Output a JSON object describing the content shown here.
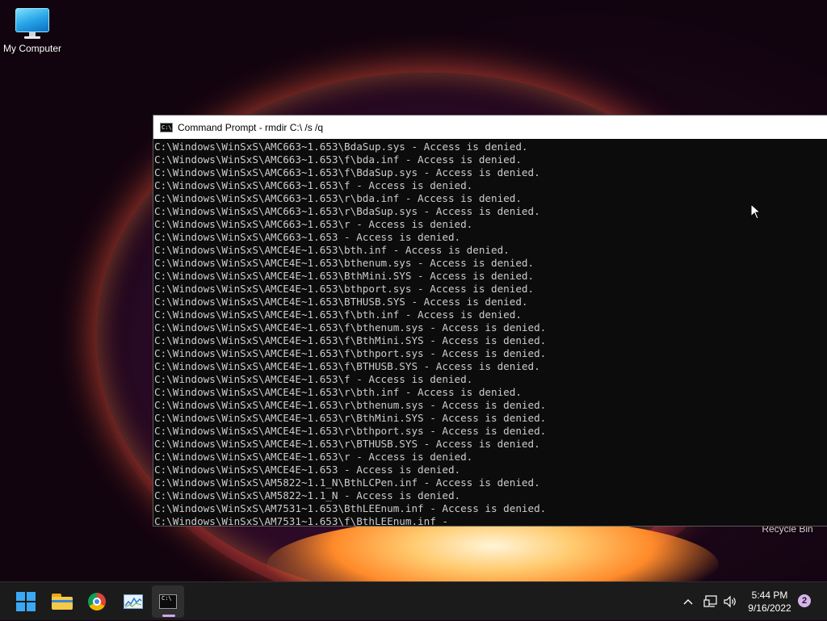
{
  "desktop": {
    "icons": [
      {
        "label": "My Computer",
        "icon": "monitor-icon"
      },
      {
        "label": "Recycle Bin",
        "icon": "recycle-bin-icon"
      }
    ]
  },
  "cmd_window": {
    "title": "Command Prompt - rmdir  C:\\ /s /q",
    "icon": "terminal-icon",
    "output_lines": [
      "C:\\Windows\\WinSxS\\AMC663~1.653\\BdaSup.sys - Access is denied.",
      "C:\\Windows\\WinSxS\\AMC663~1.653\\f\\bda.inf - Access is denied.",
      "C:\\Windows\\WinSxS\\AMC663~1.653\\f\\BdaSup.sys - Access is denied.",
      "C:\\Windows\\WinSxS\\AMC663~1.653\\f - Access is denied.",
      "C:\\Windows\\WinSxS\\AMC663~1.653\\r\\bda.inf - Access is denied.",
      "C:\\Windows\\WinSxS\\AMC663~1.653\\r\\BdaSup.sys - Access is denied.",
      "C:\\Windows\\WinSxS\\AMC663~1.653\\r - Access is denied.",
      "C:\\Windows\\WinSxS\\AMC663~1.653 - Access is denied.",
      "C:\\Windows\\WinSxS\\AMCE4E~1.653\\bth.inf - Access is denied.",
      "C:\\Windows\\WinSxS\\AMCE4E~1.653\\bthenum.sys - Access is denied.",
      "C:\\Windows\\WinSxS\\AMCE4E~1.653\\BthMini.SYS - Access is denied.",
      "C:\\Windows\\WinSxS\\AMCE4E~1.653\\bthport.sys - Access is denied.",
      "C:\\Windows\\WinSxS\\AMCE4E~1.653\\BTHUSB.SYS - Access is denied.",
      "C:\\Windows\\WinSxS\\AMCE4E~1.653\\f\\bth.inf - Access is denied.",
      "C:\\Windows\\WinSxS\\AMCE4E~1.653\\f\\bthenum.sys - Access is denied.",
      "C:\\Windows\\WinSxS\\AMCE4E~1.653\\f\\BthMini.SYS - Access is denied.",
      "C:\\Windows\\WinSxS\\AMCE4E~1.653\\f\\bthport.sys - Access is denied.",
      "C:\\Windows\\WinSxS\\AMCE4E~1.653\\f\\BTHUSB.SYS - Access is denied.",
      "C:\\Windows\\WinSxS\\AMCE4E~1.653\\f - Access is denied.",
      "C:\\Windows\\WinSxS\\AMCE4E~1.653\\r\\bth.inf - Access is denied.",
      "C:\\Windows\\WinSxS\\AMCE4E~1.653\\r\\bthenum.sys - Access is denied.",
      "C:\\Windows\\WinSxS\\AMCE4E~1.653\\r\\BthMini.SYS - Access is denied.",
      "C:\\Windows\\WinSxS\\AMCE4E~1.653\\r\\bthport.sys - Access is denied.",
      "C:\\Windows\\WinSxS\\AMCE4E~1.653\\r\\BTHUSB.SYS - Access is denied.",
      "C:\\Windows\\WinSxS\\AMCE4E~1.653\\r - Access is denied.",
      "C:\\Windows\\WinSxS\\AMCE4E~1.653 - Access is denied.",
      "C:\\Windows\\WinSxS\\AM5822~1.1_N\\BthLCPen.inf - Access is denied.",
      "C:\\Windows\\WinSxS\\AM5822~1.1_N - Access is denied.",
      "C:\\Windows\\WinSxS\\AM7531~1.653\\BthLEEnum.inf - Access is denied.",
      "C:\\Windows\\WinSxS\\AM7531~1.653\\f\\BthLEEnum.inf -"
    ]
  },
  "taskbar": {
    "apps": [
      {
        "name": "start",
        "icon": "windows-logo-icon"
      },
      {
        "name": "file-explorer",
        "icon": "folder-icon"
      },
      {
        "name": "chrome",
        "icon": "chrome-icon"
      },
      {
        "name": "performance-monitor",
        "icon": "performance-monitor-icon"
      },
      {
        "name": "command-prompt",
        "icon": "terminal-icon",
        "active": true
      }
    ],
    "tray": {
      "icons": [
        "chevron-up-icon",
        "network-icon",
        "volume-icon"
      ],
      "time": "5:44 PM",
      "date": "9/16/2022",
      "notification_count": "2"
    }
  },
  "colors": {
    "terminal_bg": "#0c0c0c",
    "terminal_fg": "#cccccc",
    "taskbar_bg": "#1b1b1b",
    "accent": "#d3a6ea"
  }
}
